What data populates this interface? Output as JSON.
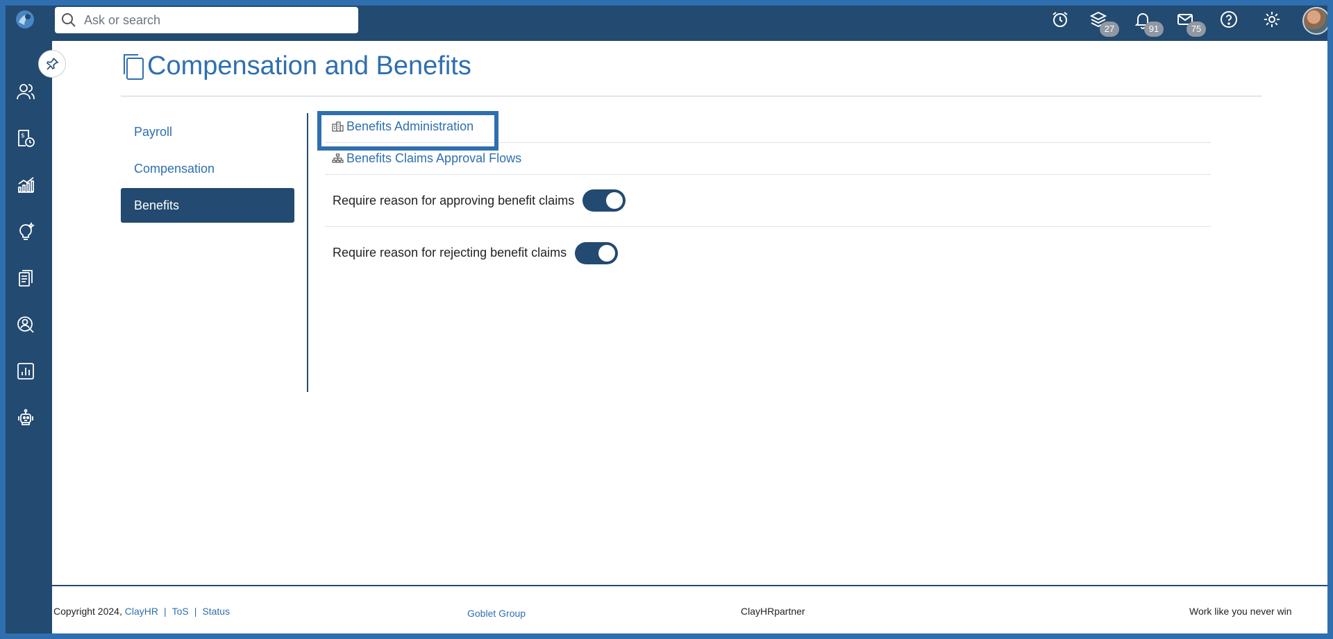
{
  "search": {
    "placeholder": "Ask or search"
  },
  "header": {
    "badges": {
      "layers": "27",
      "notifications": "91",
      "mail": "75"
    }
  },
  "page": {
    "title": "Compensation and Benefits"
  },
  "subnav": {
    "items": [
      {
        "label": "Payroll"
      },
      {
        "label": "Compensation"
      },
      {
        "label": "Benefits"
      }
    ]
  },
  "content": {
    "links": [
      {
        "label": "Benefits Administration",
        "icon": "building-icon"
      },
      {
        "label": "Benefits Claims Approval Flows",
        "icon": "sitemap-icon"
      }
    ],
    "settings": [
      {
        "label": "Require reason for approving benefit claims",
        "enabled": true
      },
      {
        "label": "Require reason for rejecting benefit claims",
        "enabled": true
      }
    ]
  },
  "footer": {
    "copyright": "Copyright 2024,",
    "brand": "ClayHR",
    "tos": "ToS",
    "status": "Status",
    "sep": "|",
    "group": "Goblet Group",
    "partner": "ClayHRpartner",
    "tagline": "Work like you never win"
  },
  "colors": {
    "primary": "#234a70",
    "accent": "#2f6fb0",
    "badge": "#8f98a3"
  }
}
